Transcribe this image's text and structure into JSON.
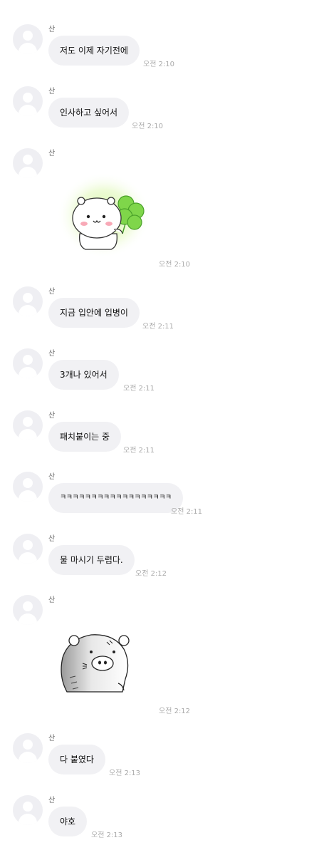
{
  "messages": [
    {
      "sender": "산",
      "text": "저도 이제 자기전에",
      "time": "오전 2:10"
    },
    {
      "sender": "산",
      "text": "인사하고 싶어서",
      "time": "오전 2:10"
    },
    {
      "sender": "산",
      "sticker": "clover-bear-sticker",
      "time": "오전 2:10"
    },
    {
      "sender": "산",
      "text": "지금 입안에 입병이",
      "time": "오전 2:11"
    },
    {
      "sender": "산",
      "text": "3개나 있어서",
      "time": "오전 2:11"
    },
    {
      "sender": "산",
      "text": "패치붙이는 중",
      "time": "오전 2:11"
    },
    {
      "sender": "산",
      "text": "ㅋㅋㅋㅋㅋㅋㅋㅋㅋㅋㅋㅋㅋㅋㅋㅋㅋㅋ",
      "time": "오전 2:11"
    },
    {
      "sender": "산",
      "text": "물 마시기 두렵다.",
      "time": "오전 2:12"
    },
    {
      "sender": "산",
      "sticker": "scared-bear-sticker",
      "time": "오전 2:12"
    },
    {
      "sender": "산",
      "text": "다 붙였다",
      "time": "오전 2:13"
    },
    {
      "sender": "산",
      "text": "야호",
      "time": "오전 2:13"
    }
  ]
}
